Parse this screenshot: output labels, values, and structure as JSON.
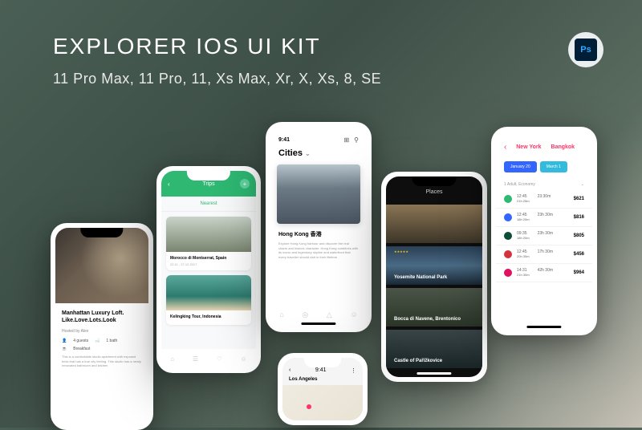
{
  "title": "EXPLORER IOS UI KIT",
  "subtitle": "11 Pro Max, 11 Pro, 11, Xs Max, Xr, X, Xs, 8, SE",
  "ps_label": "Ps",
  "phone1": {
    "listing_title": "Manhattan Luxury Loft. Like.Love.Lots.Look",
    "host": "Hosted by Alex",
    "guests": "4 guests",
    "bath": "1 bath",
    "breakfast": "Breakfast",
    "desc": "This is a comfortable studio apartment with exposed brick that has a true city feeling. This studio has a newly renovated bathroom and kitchen"
  },
  "phone2": {
    "header": "Trips",
    "tab": "Nearest",
    "card1_name": "Morocco di Montserrat, Spain",
    "card1_date": "22.11 - 27.12.2017",
    "card2_name": "Kelingking Tour, Indonesia"
  },
  "phone3": {
    "time": "9:41",
    "title": "Cities",
    "hero_name": "Hong Kong 香港",
    "hero_desc": "Explore Hong Kong harbour and discover the real charm and historic character. Hong Kong combines with its iconic and legendary skyline and waterfront that every traveller should visit in their lifetime"
  },
  "phone4": {
    "time": "9:41",
    "location": "Los Angeles"
  },
  "phone5": {
    "title": "Places",
    "r1": "",
    "r2": "Yosemite National Park",
    "r3": "Bocca di Navene, Brentonico",
    "r4": "Castle of Pařížkovice",
    "stars": "★★★★★"
  },
  "phone6": {
    "city1": "New York",
    "city2": "Bangkok",
    "chip1": "January 20",
    "chip2": "March 1",
    "section": "1 Adult, Economy",
    "flights": [
      {
        "t1": "12:45",
        "d1": "21h 25m",
        "t2": "23:30m",
        "price": "$621"
      },
      {
        "t1": "12:45",
        "d1": "18h 20m",
        "t2": "23h 30m",
        "price": "$816"
      },
      {
        "t1": "09:35",
        "d1": "18h 20m",
        "t2": "23h 30m",
        "price": "$805"
      },
      {
        "t1": "12:45",
        "d1": "20h 30m",
        "t2": "17h 30m",
        "price": "$456"
      },
      {
        "t1": "14:31",
        "d1": "21h 30m",
        "t2": "42h 30m",
        "price": "$964"
      }
    ]
  }
}
